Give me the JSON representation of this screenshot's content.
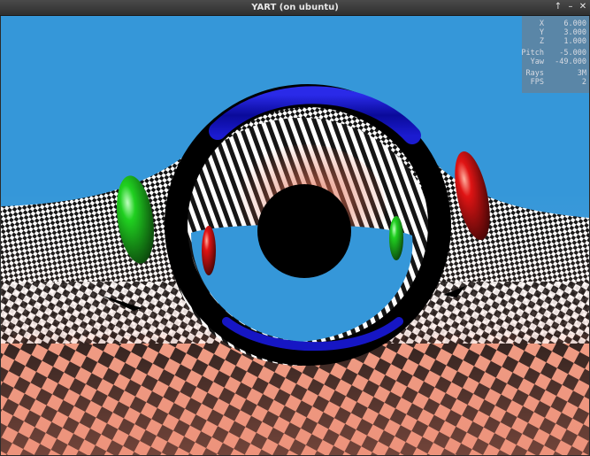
{
  "window": {
    "title": "YART (on ubuntu)",
    "controls": {
      "maximize": "↑",
      "minimize": "–",
      "close": "✕"
    }
  },
  "hud": {
    "rows": [
      {
        "label": "X",
        "value": "6.000"
      },
      {
        "label": "Y",
        "value": "3.000"
      },
      {
        "label": "Z",
        "value": "1.000"
      },
      {
        "label": "Pitch",
        "value": "-5.000"
      },
      {
        "label": "Yaw",
        "value": "-49.000"
      },
      {
        "label": "Rays",
        "value": "3M"
      },
      {
        "label": "FPS",
        "value": "2"
      }
    ]
  },
  "colors": {
    "sky": "#3597d9",
    "checker_warm": "#e79a86",
    "ring": "#1010d8",
    "sphere_green": "#17c617",
    "sphere_red": "#d21010"
  }
}
